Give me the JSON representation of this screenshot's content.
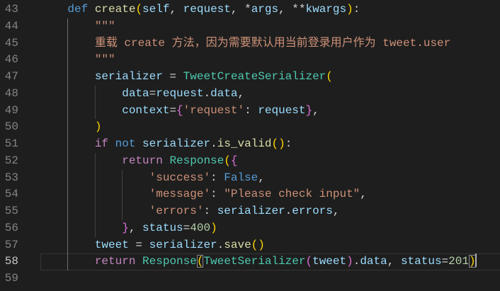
{
  "editor": {
    "active_line": 58,
    "colors": {
      "background": "#1e1e1e",
      "line_number": "#858585",
      "line_number_active": "#c6c6c6",
      "current_line_border": "#353535",
      "indent_guide": "#404040",
      "indent_guide_active": "#707070",
      "bracket_match_border": "#888888",
      "cursor": "#aeafad"
    },
    "lines": [
      {
        "number": "43",
        "tokens": [
          {
            "text": "    ",
            "color": "#d4d4d4"
          },
          {
            "text": "def",
            "color": "#569cd6"
          },
          {
            "text": " ",
            "color": "#d4d4d4"
          },
          {
            "text": "create",
            "color": "#dcdcaa"
          },
          {
            "text": "(",
            "color": "#ffd700"
          },
          {
            "text": "self",
            "color": "#9cdcfe"
          },
          {
            "text": ", ",
            "color": "#d4d4d4"
          },
          {
            "text": "request",
            "color": "#9cdcfe"
          },
          {
            "text": ", ",
            "color": "#d4d4d4"
          },
          {
            "text": "*",
            "color": "#d4d4d4"
          },
          {
            "text": "args",
            "color": "#9cdcfe"
          },
          {
            "text": ", ",
            "color": "#d4d4d4"
          },
          {
            "text": "**",
            "color": "#d4d4d4"
          },
          {
            "text": "kwargs",
            "color": "#9cdcfe"
          },
          {
            "text": ")",
            "color": "#ffd700"
          },
          {
            "text": ":",
            "color": "#d4d4d4"
          }
        ]
      },
      {
        "number": "44",
        "tokens": [
          {
            "text": "        ",
            "color": "#d4d4d4"
          },
          {
            "text": "\"\"\"",
            "color": "#ce9178"
          }
        ]
      },
      {
        "number": "45",
        "tokens": [
          {
            "text": "        ",
            "color": "#d4d4d4"
          },
          {
            "text": "重载 create 方法，因为需要默认用当前登录用户作为 tweet.user",
            "color": "#ce9178"
          }
        ]
      },
      {
        "number": "46",
        "tokens": [
          {
            "text": "        ",
            "color": "#d4d4d4"
          },
          {
            "text": "\"\"\"",
            "color": "#ce9178"
          }
        ]
      },
      {
        "number": "47",
        "tokens": [
          {
            "text": "        ",
            "color": "#d4d4d4"
          },
          {
            "text": "serializer",
            "color": "#9cdcfe"
          },
          {
            "text": " = ",
            "color": "#d4d4d4"
          },
          {
            "text": "TweetCreateSerializer",
            "color": "#4ec9b0"
          },
          {
            "text": "(",
            "color": "#ffd700"
          }
        ]
      },
      {
        "number": "48",
        "tokens": [
          {
            "text": "            ",
            "color": "#d4d4d4"
          },
          {
            "text": "data",
            "color": "#9cdcfe"
          },
          {
            "text": "=",
            "color": "#d4d4d4"
          },
          {
            "text": "request",
            "color": "#9cdcfe"
          },
          {
            "text": ".",
            "color": "#d4d4d4"
          },
          {
            "text": "data",
            "color": "#9cdcfe"
          },
          {
            "text": ",",
            "color": "#d4d4d4"
          }
        ]
      },
      {
        "number": "49",
        "tokens": [
          {
            "text": "            ",
            "color": "#d4d4d4"
          },
          {
            "text": "context",
            "color": "#9cdcfe"
          },
          {
            "text": "=",
            "color": "#d4d4d4"
          },
          {
            "text": "{",
            "color": "#da70d6"
          },
          {
            "text": "'request'",
            "color": "#ce9178"
          },
          {
            "text": ": ",
            "color": "#d4d4d4"
          },
          {
            "text": "request",
            "color": "#9cdcfe"
          },
          {
            "text": "}",
            "color": "#da70d6"
          },
          {
            "text": ",",
            "color": "#d4d4d4"
          }
        ]
      },
      {
        "number": "50",
        "tokens": [
          {
            "text": "        ",
            "color": "#d4d4d4"
          },
          {
            "text": ")",
            "color": "#ffd700"
          }
        ]
      },
      {
        "number": "51",
        "tokens": [
          {
            "text": "        ",
            "color": "#d4d4d4"
          },
          {
            "text": "if",
            "color": "#c586c0"
          },
          {
            "text": " ",
            "color": "#d4d4d4"
          },
          {
            "text": "not",
            "color": "#569cd6"
          },
          {
            "text": " ",
            "color": "#d4d4d4"
          },
          {
            "text": "serializer",
            "color": "#9cdcfe"
          },
          {
            "text": ".",
            "color": "#d4d4d4"
          },
          {
            "text": "is_valid",
            "color": "#dcdcaa"
          },
          {
            "text": "()",
            "color": "#ffd700"
          },
          {
            "text": ":",
            "color": "#d4d4d4"
          }
        ]
      },
      {
        "number": "52",
        "tokens": [
          {
            "text": "            ",
            "color": "#d4d4d4"
          },
          {
            "text": "return",
            "color": "#c586c0"
          },
          {
            "text": " ",
            "color": "#d4d4d4"
          },
          {
            "text": "Response",
            "color": "#4ec9b0"
          },
          {
            "text": "(",
            "color": "#ffd700"
          },
          {
            "text": "{",
            "color": "#da70d6"
          }
        ]
      },
      {
        "number": "53",
        "tokens": [
          {
            "text": "                ",
            "color": "#d4d4d4"
          },
          {
            "text": "'success'",
            "color": "#ce9178"
          },
          {
            "text": ": ",
            "color": "#d4d4d4"
          },
          {
            "text": "False",
            "color": "#569cd6"
          },
          {
            "text": ",",
            "color": "#d4d4d4"
          }
        ]
      },
      {
        "number": "54",
        "tokens": [
          {
            "text": "                ",
            "color": "#d4d4d4"
          },
          {
            "text": "'message'",
            "color": "#ce9178"
          },
          {
            "text": ": ",
            "color": "#d4d4d4"
          },
          {
            "text": "\"Please check input\"",
            "color": "#ce9178"
          },
          {
            "text": ",",
            "color": "#d4d4d4"
          }
        ]
      },
      {
        "number": "55",
        "tokens": [
          {
            "text": "                ",
            "color": "#d4d4d4"
          },
          {
            "text": "'errors'",
            "color": "#ce9178"
          },
          {
            "text": ": ",
            "color": "#d4d4d4"
          },
          {
            "text": "serializer",
            "color": "#9cdcfe"
          },
          {
            "text": ".",
            "color": "#d4d4d4"
          },
          {
            "text": "errors",
            "color": "#9cdcfe"
          },
          {
            "text": ",",
            "color": "#d4d4d4"
          }
        ]
      },
      {
        "number": "56",
        "tokens": [
          {
            "text": "            ",
            "color": "#d4d4d4"
          },
          {
            "text": "}",
            "color": "#da70d6"
          },
          {
            "text": ", ",
            "color": "#d4d4d4"
          },
          {
            "text": "status",
            "color": "#9cdcfe"
          },
          {
            "text": "=",
            "color": "#d4d4d4"
          },
          {
            "text": "400",
            "color": "#b5cea8"
          },
          {
            "text": ")",
            "color": "#ffd700"
          }
        ]
      },
      {
        "number": "57",
        "tokens": [
          {
            "text": "        ",
            "color": "#d4d4d4"
          },
          {
            "text": "tweet",
            "color": "#9cdcfe"
          },
          {
            "text": " = ",
            "color": "#d4d4d4"
          },
          {
            "text": "serializer",
            "color": "#9cdcfe"
          },
          {
            "text": ".",
            "color": "#d4d4d4"
          },
          {
            "text": "save",
            "color": "#dcdcaa"
          },
          {
            "text": "()",
            "color": "#ffd700"
          }
        ]
      },
      {
        "number": "58",
        "tokens": [
          {
            "text": "        ",
            "color": "#d4d4d4"
          },
          {
            "text": "return",
            "color": "#c586c0"
          },
          {
            "text": " ",
            "color": "#d4d4d4"
          },
          {
            "text": "Response",
            "color": "#4ec9b0"
          },
          {
            "text": "(",
            "color": "#ffd700",
            "match": true
          },
          {
            "text": "TweetSerializer",
            "color": "#4ec9b0"
          },
          {
            "text": "(",
            "color": "#da70d6"
          },
          {
            "text": "tweet",
            "color": "#9cdcfe"
          },
          {
            "text": ")",
            "color": "#da70d6"
          },
          {
            "text": ".",
            "color": "#d4d4d4"
          },
          {
            "text": "data",
            "color": "#9cdcfe"
          },
          {
            "text": ", ",
            "color": "#d4d4d4"
          },
          {
            "text": "status",
            "color": "#9cdcfe"
          },
          {
            "text": "=",
            "color": "#d4d4d4"
          },
          {
            "text": "201",
            "color": "#b5cea8"
          },
          {
            "text": ")",
            "color": "#ffd700",
            "match": true
          }
        ]
      },
      {
        "number": "59",
        "tokens": []
      }
    ]
  }
}
